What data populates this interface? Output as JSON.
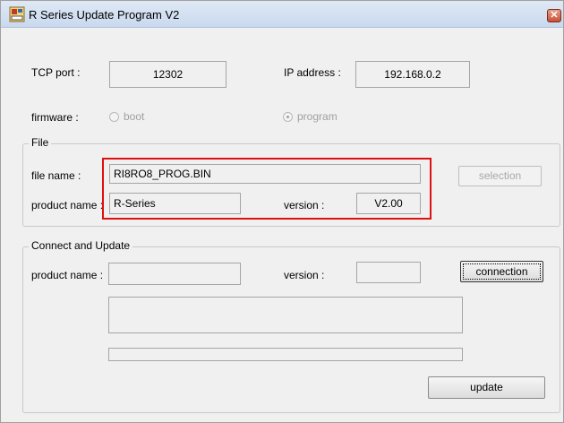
{
  "window": {
    "title": "R Series Update Program V2",
    "close_glyph": "✕"
  },
  "network": {
    "tcp_port_label": "TCP port :",
    "tcp_port_value": "12302",
    "ip_label": "IP address :",
    "ip_value": "192.168.0.2"
  },
  "firmware": {
    "label": "firmware :",
    "options": [
      {
        "label": "boot",
        "selected": false
      },
      {
        "label": "program",
        "selected": true
      }
    ]
  },
  "file_group": {
    "title": "File",
    "file_name_label": "file name :",
    "file_name_value": "RI8RO8_PROG.BIN",
    "product_name_label": "product name :",
    "product_name_value": "R-Series",
    "version_label": "version :",
    "version_value": "V2.00",
    "selection_button": "selection"
  },
  "connect_group": {
    "title": "Connect and Update",
    "product_name_label": "product name :",
    "product_name_value": "",
    "version_label": "version :",
    "version_value": "",
    "connection_button": "connection",
    "update_button": "update",
    "log_value": ""
  },
  "colors": {
    "highlight": "#e01010",
    "window_bg": "#f0f0f0"
  }
}
